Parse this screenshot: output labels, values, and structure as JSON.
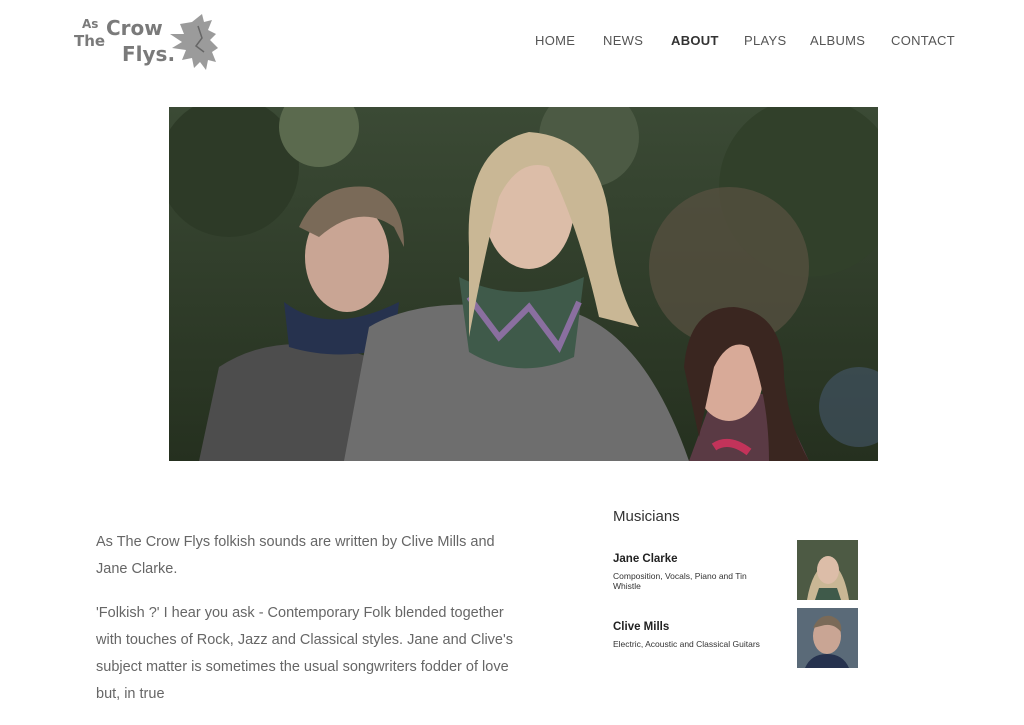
{
  "logo": {
    "line1": "As",
    "line2": "The",
    "word_crow": "Crow",
    "word_flys": "Flys."
  },
  "nav": [
    {
      "label": "HOME",
      "active": false
    },
    {
      "label": "NEWS",
      "active": false
    },
    {
      "label": "ABOUT",
      "active": true
    },
    {
      "label": "PLAYS",
      "active": false
    },
    {
      "label": "ALBUMS",
      "active": false
    },
    {
      "label": "CONTACT",
      "active": false
    }
  ],
  "intro": {
    "p1": "As The Crow Flys folkish sounds are written by Clive Mills and Jane Clarke.",
    "p2": "'Folkish ?' I hear you ask - Contemporary Folk blended together with touches of Rock, Jazz and Classical styles. Jane and Clive's subject matter is sometimes the usual songwriters fodder of love but, in true"
  },
  "musicians": {
    "title": "Musicians",
    "list": [
      {
        "name": "Jane Clarke",
        "role": "Composition, Vocals, Piano and Tin Whistle"
      },
      {
        "name": "Clive Mills",
        "role": "Electric, Acoustic and Classical Guitars"
      }
    ]
  },
  "colors": {
    "nav_text": "#555555",
    "nav_active": "#333333",
    "body_text": "#666666",
    "logo_grey": "#7a7a7a"
  }
}
